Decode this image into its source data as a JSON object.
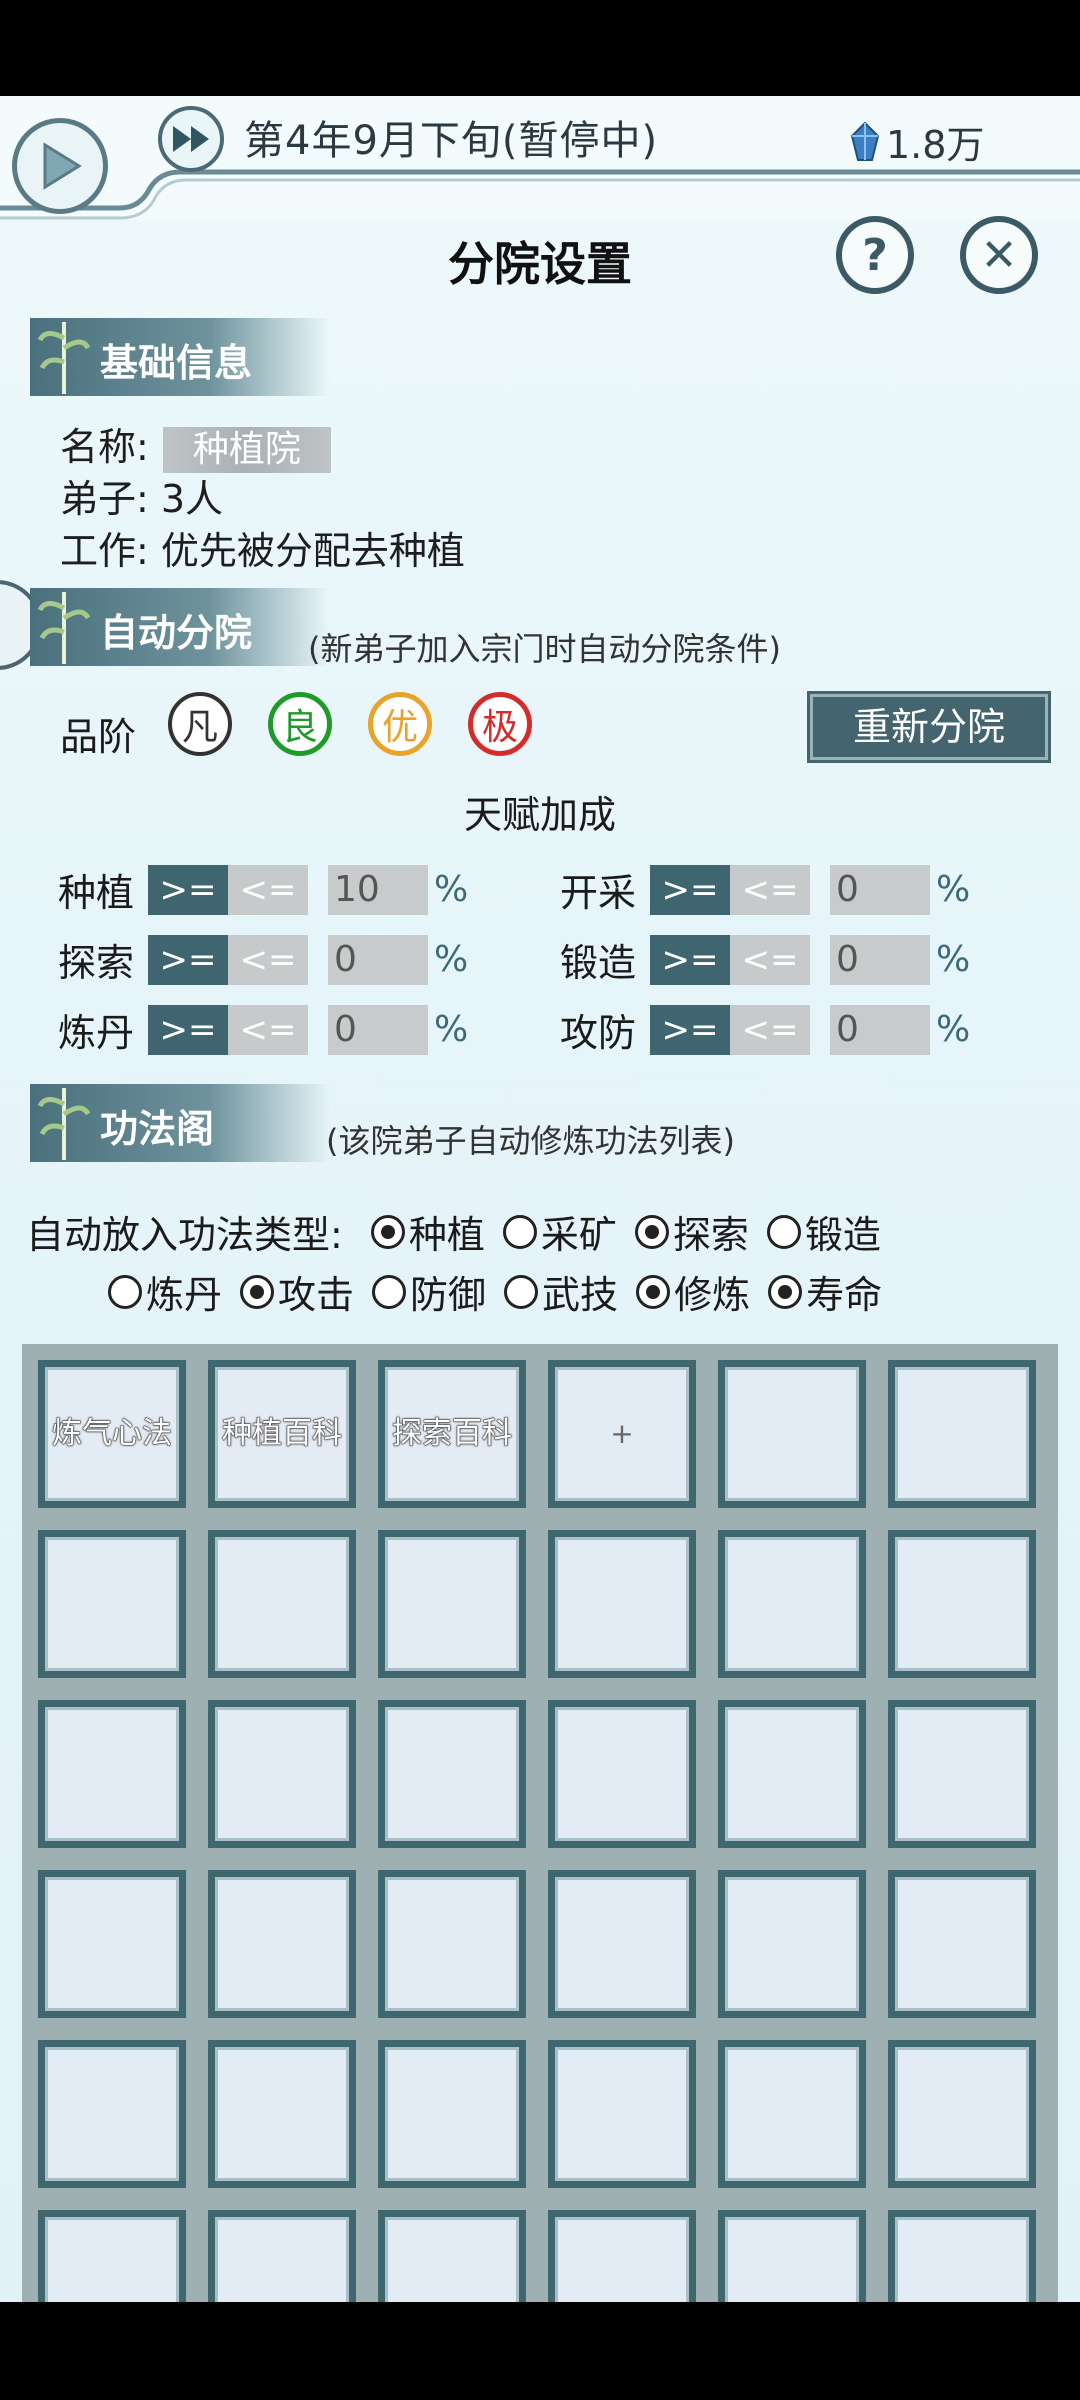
{
  "topbar": {
    "date": "第4年9月下旬(暂停中)",
    "currency": "1.8万",
    "accent": "#4a6a77"
  },
  "title": "分院设置",
  "buttons": {
    "help": "?",
    "close": "✕"
  },
  "basic": {
    "header": "基础信息",
    "name_label": "名称:",
    "name_value": "种植院",
    "disciples": "弟子: 3人",
    "work": "工作: 优先被分配去种植"
  },
  "auto": {
    "header": "自动分院",
    "subtitle": "(新弟子加入宗门时自动分院条件)",
    "grade_label": "品阶",
    "grades": [
      {
        "label": "凡",
        "color": "#333333"
      },
      {
        "label": "良",
        "color": "#1f9b2a"
      },
      {
        "label": "优",
        "color": "#e9a32b"
      },
      {
        "label": "极",
        "color": "#d62b2b"
      }
    ],
    "redo_button": "重新分院",
    "bonus_title": "天赋加成",
    "ge": ">=",
    "le": "<=",
    "pct": "%",
    "talents": [
      {
        "name": "种植",
        "value": "10"
      },
      {
        "name": "开采",
        "value": "0"
      },
      {
        "name": "探索",
        "value": "0"
      },
      {
        "name": "锻造",
        "value": "0"
      },
      {
        "name": "炼丹",
        "value": "0"
      },
      {
        "name": "攻防",
        "value": "0"
      }
    ]
  },
  "skills": {
    "header": "功法阁",
    "subtitle": "(该院弟子自动修炼功法列表)",
    "type_label": "自动放入功法类型:",
    "types": [
      {
        "label": "种植",
        "checked": true
      },
      {
        "label": "采矿",
        "checked": false
      },
      {
        "label": "探索",
        "checked": true
      },
      {
        "label": "锻造",
        "checked": false
      },
      {
        "label": "炼丹",
        "checked": false
      },
      {
        "label": "攻击",
        "checked": true
      },
      {
        "label": "防御",
        "checked": false
      },
      {
        "label": "武技",
        "checked": false
      },
      {
        "label": "修炼",
        "checked": true
      },
      {
        "label": "寿命",
        "checked": true
      }
    ],
    "slots": [
      "炼气心法",
      "种植百科",
      "探索百科",
      "+"
    ]
  }
}
